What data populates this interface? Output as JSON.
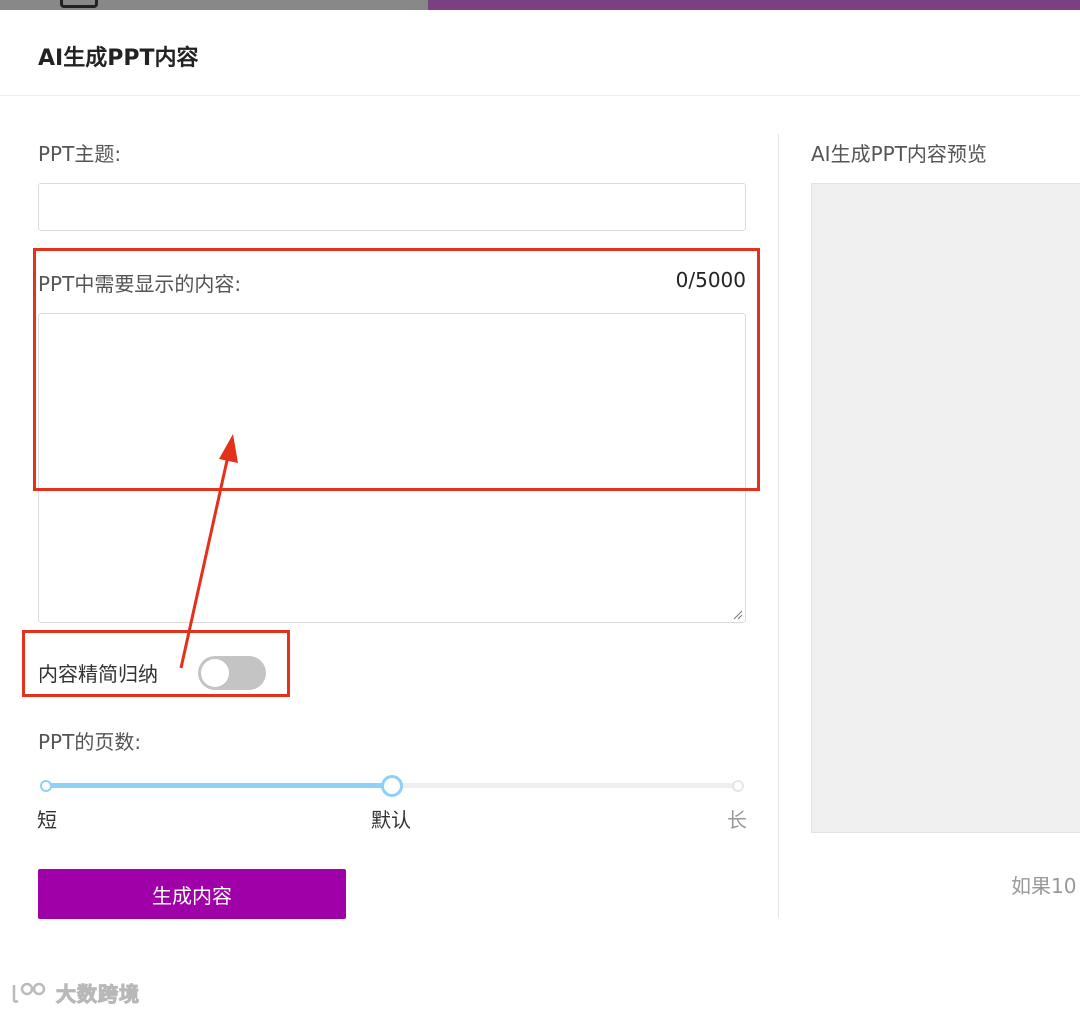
{
  "modal": {
    "title": "AI生成PPT内容"
  },
  "form": {
    "topic_label": "PPT主题:",
    "topic_value": "",
    "content_label": "PPT中需要显示的内容:",
    "content_counter": "0/5000",
    "content_value": "",
    "summarize_label": "内容精简归纳",
    "summarize_enabled": false,
    "pages_label": "PPT的页数:",
    "pages_options": [
      "短",
      "默认",
      "长"
    ],
    "pages_selected": "默认",
    "pages_slider_fraction": 0.5,
    "generate_label": "生成内容"
  },
  "preview": {
    "title": "AI生成PPT内容预览",
    "hint": "如果10"
  },
  "watermark": {
    "text": "大数跨境"
  },
  "colors": {
    "primary_button": "#a000a8",
    "slider_accent": "#8fd0f7",
    "annotation": "#e3311b",
    "top_strip_purple": "#7b3f82"
  }
}
